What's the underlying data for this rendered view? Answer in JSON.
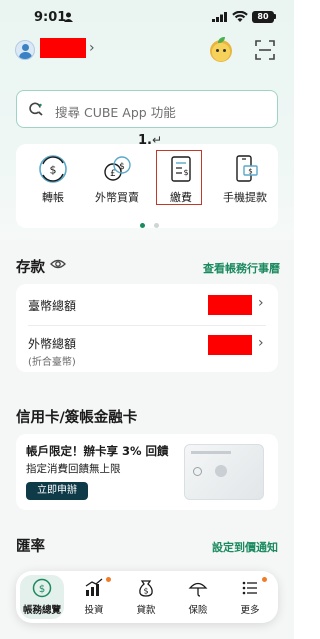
{
  "status_bar": {
    "time": "9:01",
    "battery": "80"
  },
  "header": {
    "chevron": "›"
  },
  "search": {
    "placeholder": "搜尋 CUBE App 功能"
  },
  "annotation": {
    "label": "1.",
    "arrow": "↵"
  },
  "quick_actions": [
    {
      "label": "轉帳",
      "icon": "transfer-icon"
    },
    {
      "label": "外幣買賣",
      "icon": "foreign-exchange-icon"
    },
    {
      "label": "繳費",
      "icon": "bill-payment-icon"
    },
    {
      "label": "手機提款",
      "icon": "mobile-withdraw-icon"
    }
  ],
  "deposit": {
    "title": "存款",
    "link": "查看帳務行事曆",
    "rows": [
      {
        "label": "臺幣總額",
        "sub": ""
      },
      {
        "label": "外幣總額",
        "sub": "(折合臺幣)"
      }
    ]
  },
  "credit": {
    "title": "信用卡/簽帳金融卡",
    "promo_title": "帳戶限定！辦卡享 3% 回饋",
    "promo_sub": "指定消費回饋無上限",
    "promo_button": "立即申辦"
  },
  "exchange": {
    "title": "匯率",
    "link": "設定到價通知"
  },
  "bottom_nav": [
    {
      "label": "帳務總覽",
      "icon": "account-overview-icon",
      "active": true
    },
    {
      "label": "投資",
      "icon": "invest-icon",
      "active": false
    },
    {
      "label": "貸款",
      "icon": "loan-icon",
      "active": false
    },
    {
      "label": "保險",
      "icon": "insurance-icon",
      "active": false
    },
    {
      "label": "更多",
      "icon": "more-icon",
      "active": false
    }
  ],
  "colors": {
    "accent_green": "#1a8a5f",
    "highlight_red": "#c0392b",
    "button_dark": "#0f3a48"
  }
}
